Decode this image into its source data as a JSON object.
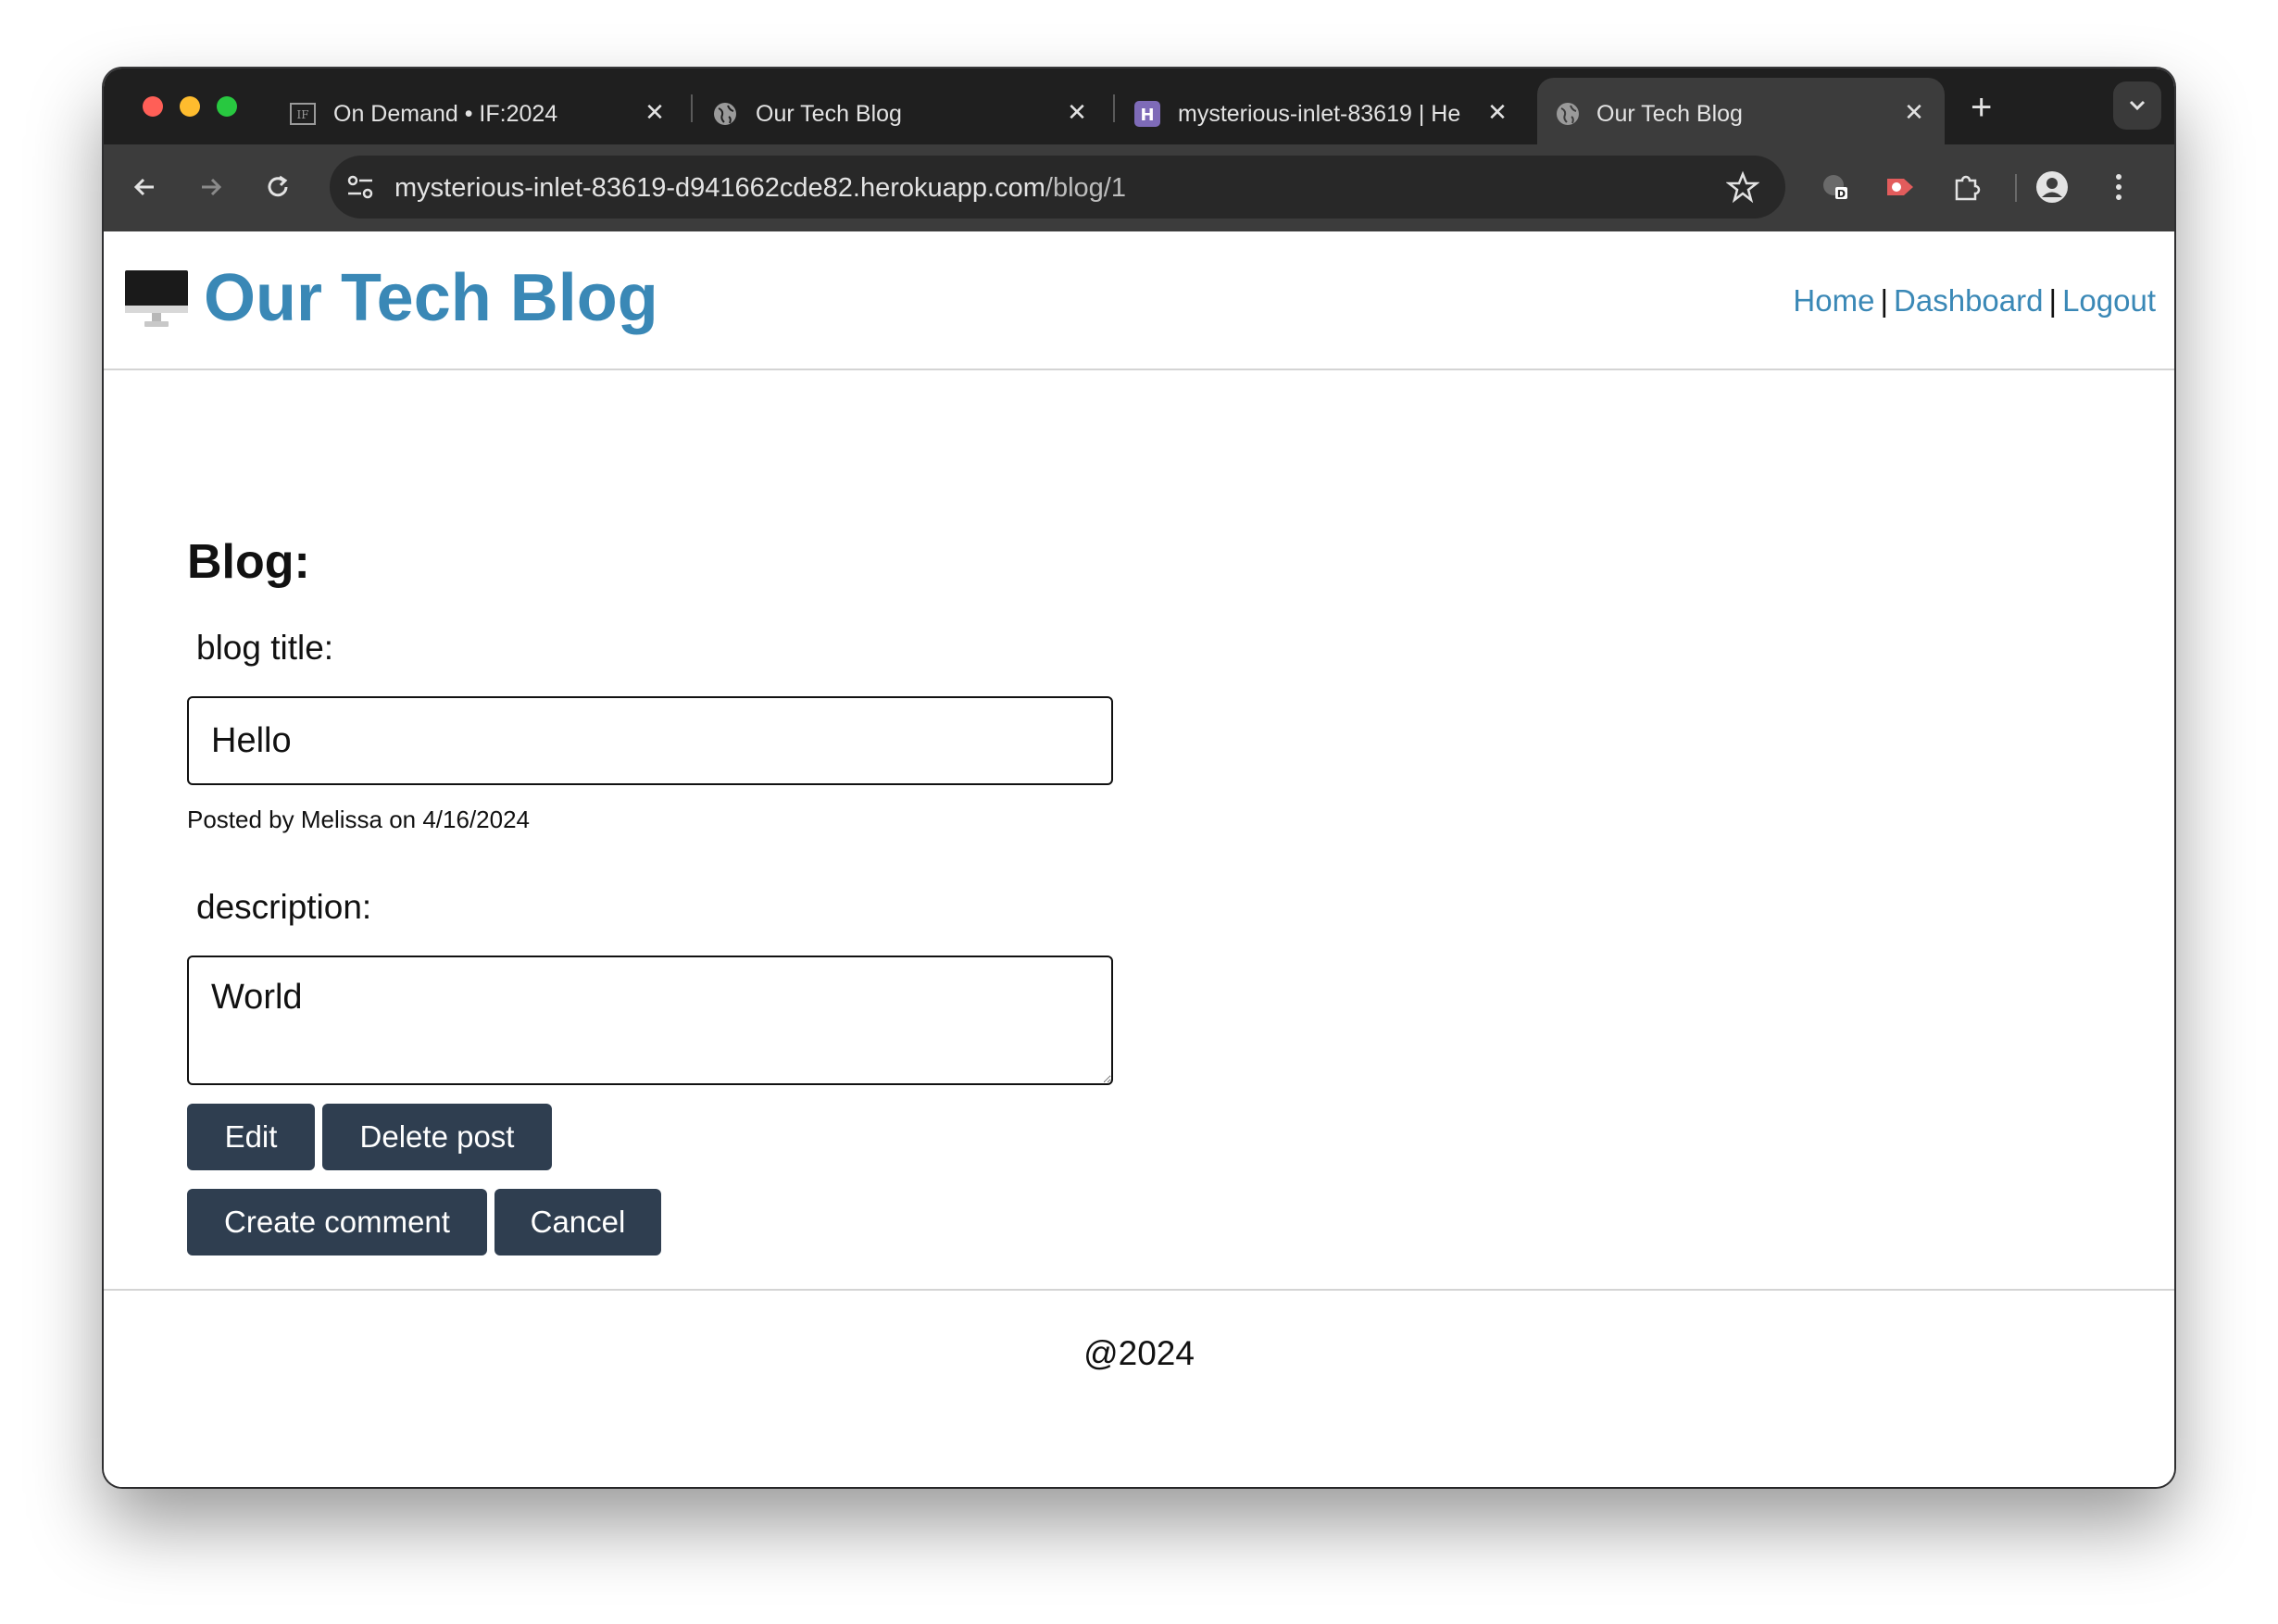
{
  "browser": {
    "tabs": [
      {
        "title": "On Demand • IF:2024",
        "active": false
      },
      {
        "title": "Our Tech Blog",
        "active": false
      },
      {
        "title": "mysterious-inlet-83619 | He",
        "active": false
      },
      {
        "title": "Our Tech Blog",
        "active": true
      }
    ],
    "new_tab": "+",
    "url_host": "mysterious-inlet-83619-d941662cde82.herokuapp.com",
    "url_path": "/blog/1"
  },
  "site": {
    "title": "Our Tech Blog",
    "nav": {
      "home": "Home",
      "dashboard": "Dashboard",
      "logout": "Logout",
      "separator": "|"
    },
    "link_color": "#3a88b6"
  },
  "blog": {
    "heading": "Blog:",
    "title_label": "blog title:",
    "title_value": "Hello",
    "posted_by": "Posted by Melissa on 4/16/2024",
    "description_label": "description:",
    "description_value": "World"
  },
  "buttons": {
    "edit": "Edit",
    "delete": "Delete post",
    "create_comment": "Create comment",
    "cancel": "Cancel",
    "color": "#2f3e50"
  },
  "footer": {
    "text": "@2024"
  }
}
